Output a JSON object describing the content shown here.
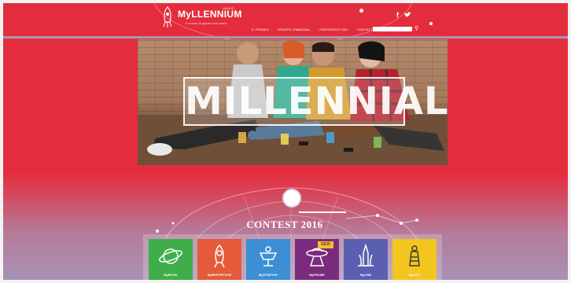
{
  "header": {
    "logo_text": "MyLLENNIUM",
    "logo_subtitle": "Il mondo di giovani che siamo",
    "logo_tag": "AWARD"
  },
  "nav": {
    "items": [
      {
        "label": "IL PREMIO"
      },
      {
        "label": "GRUPPO EMBLEMA"
      },
      {
        "label": "I PRESIDENTI DEL"
      },
      {
        "label": "CONTATTI"
      }
    ]
  },
  "hero": {
    "title": "MILLENNIALS"
  },
  "contest": {
    "title": "CONTEST 2016",
    "new_badge": "NEW",
    "tiles": [
      {
        "label_prefix": "My",
        "label": "BOOK",
        "color": "#3fae4a",
        "icon": "book-planet-icon"
      },
      {
        "label_prefix": "My",
        "label": "REPORTAGE",
        "color": "#e45a3a",
        "icon": "rocket-icon"
      },
      {
        "label_prefix": "My",
        "label": "STARTUP",
        "color": "#3d8fd4",
        "icon": "satellite-icon"
      },
      {
        "label_prefix": "My",
        "label": "FRAME",
        "color": "#7b2b7e",
        "icon": "ufo-icon"
      },
      {
        "label_prefix": "My",
        "label": "JOB",
        "color": "#5b5fb0",
        "icon": "castle-icon"
      },
      {
        "label_prefix": "My",
        "label": "CITY",
        "color": "#f3c51f",
        "icon": "lighthouse-icon"
      }
    ]
  },
  "colors": {
    "brand_red": "#e42d3c",
    "accent_lilac": "#a796b9"
  }
}
